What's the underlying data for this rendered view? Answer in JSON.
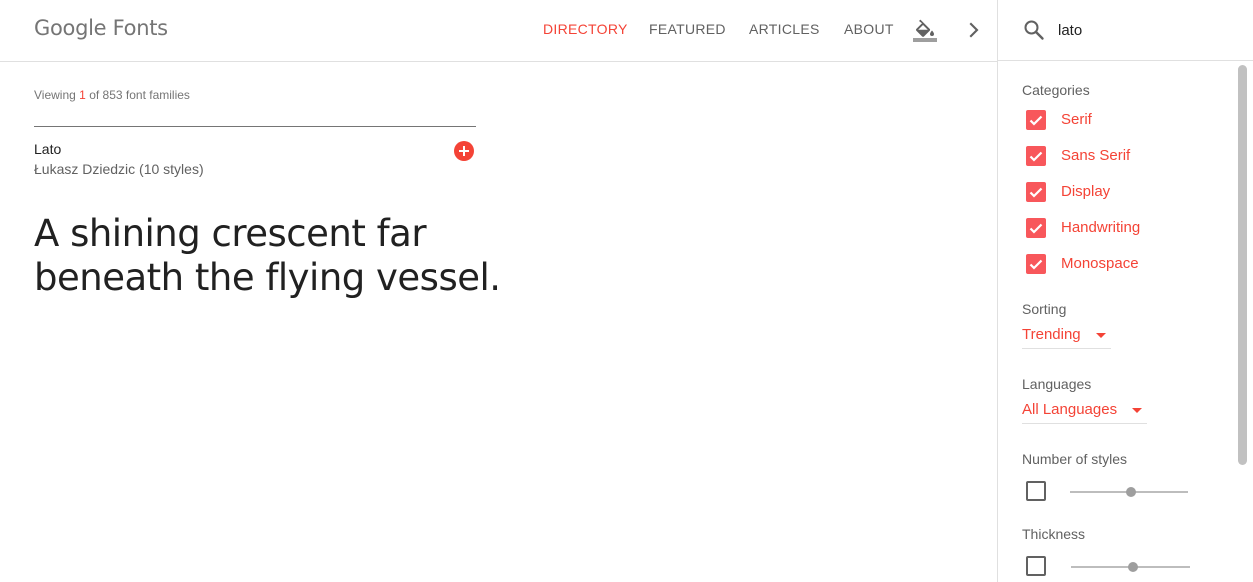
{
  "header": {
    "logo": "Google Fonts",
    "nav": [
      {
        "label": "DIRECTORY",
        "active": true
      },
      {
        "label": "FEATURED",
        "active": false
      },
      {
        "label": "ARTICLES",
        "active": false
      },
      {
        "label": "ABOUT",
        "active": false
      }
    ],
    "icons": [
      "paint-bucket-icon",
      "chevron-right-icon"
    ]
  },
  "search": {
    "icon": "search-icon",
    "value": "lato"
  },
  "results": {
    "viewing_prefix": "Viewing",
    "viewing_count": "1",
    "viewing_suffix": "of 853 font families"
  },
  "font_card": {
    "name": "Lato",
    "author": "Łukasz Dziedzic (10 styles)",
    "sample_text": "A shining crescent far beneath the flying vessel.",
    "add_icon": "plus-circle-icon"
  },
  "sidebar": {
    "categories_title": "Categories",
    "categories": [
      {
        "label": "Serif",
        "checked": true
      },
      {
        "label": "Sans Serif",
        "checked": true
      },
      {
        "label": "Display",
        "checked": true
      },
      {
        "label": "Handwriting",
        "checked": true
      },
      {
        "label": "Monospace",
        "checked": true
      }
    ],
    "sorting_title": "Sorting",
    "sorting_value": "Trending",
    "languages_title": "Languages",
    "languages_value": "All Languages",
    "styles_title": "Number of styles",
    "styles_checked": false,
    "styles_slider_position": 0.5,
    "thickness_title": "Thickness",
    "thickness_checked": false,
    "thickness_slider_position": 0.5
  },
  "colors": {
    "accent": "#f44336",
    "checkbox": "#f8575b",
    "text": "#212121",
    "muted": "#757575"
  }
}
